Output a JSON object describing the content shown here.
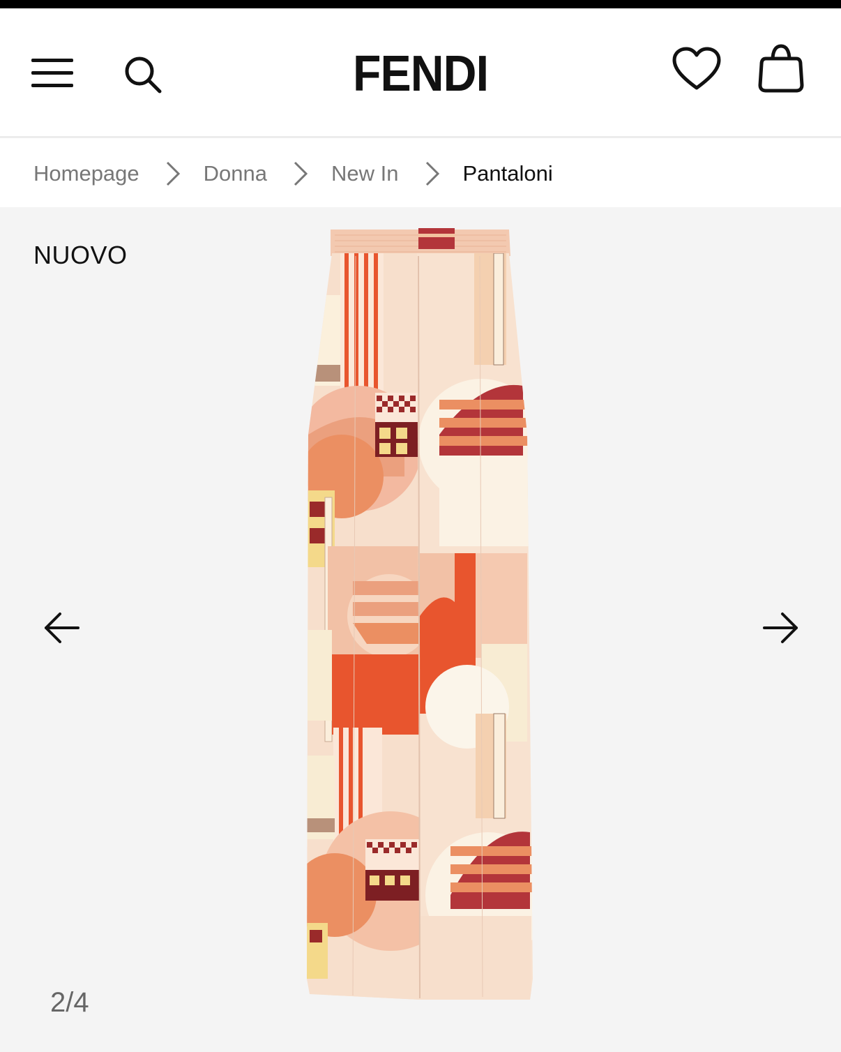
{
  "header": {
    "brand": "FENDI",
    "menu_icon": "hamburger-menu-icon",
    "search_icon": "search-icon",
    "wishlist_icon": "heart-icon",
    "bag_icon": "shopping-bag-icon"
  },
  "breadcrumb": {
    "items": [
      {
        "label": "Homepage"
      },
      {
        "label": "Donna"
      },
      {
        "label": "New In"
      },
      {
        "label": "Pantaloni"
      }
    ],
    "separator_icon": "chevron-right-icon"
  },
  "gallery": {
    "badge": "NUOVO",
    "counter": "2/4",
    "prev_icon": "arrow-left-icon",
    "next_icon": "arrow-right-icon",
    "product_image": "wide-leg-printed-silk-trousers"
  },
  "colors": {
    "background": "#f4f4f4",
    "text": "#111111",
    "muted": "#777777",
    "fabric_base": "#f7dfcc",
    "print_orange": "#e8552e",
    "print_red": "#9a2a2a",
    "print_peach": "#eba07e"
  }
}
